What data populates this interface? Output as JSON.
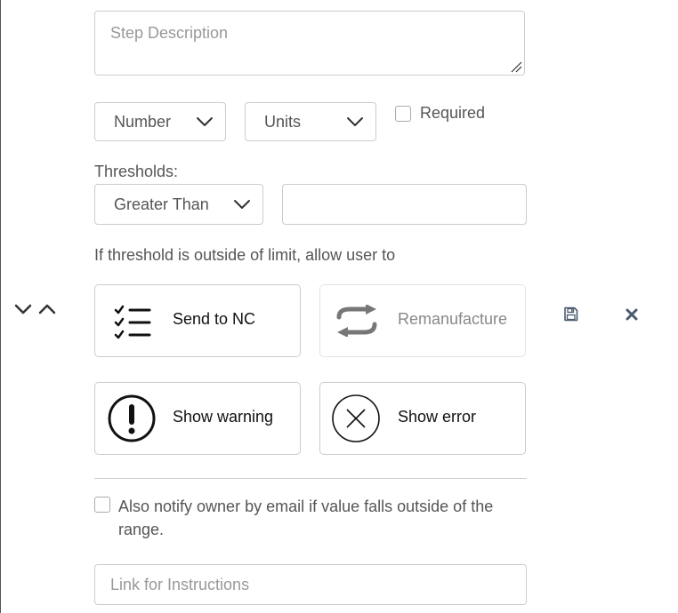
{
  "step": {
    "description_placeholder": "Step Description"
  },
  "measure": {
    "type_value": "Number",
    "units_value": "Units",
    "required_label": "Required"
  },
  "thresholds": {
    "label": "Thresholds:",
    "operator_value": "Greater Than",
    "value": ""
  },
  "outside_limit": {
    "prompt": "If threshold is outside of limit, allow user to",
    "actions": [
      {
        "label": "Send to NC",
        "icon": "checklist-icon",
        "enabled": true
      },
      {
        "label": "Remanufacture",
        "icon": "repeat-arrows-icon",
        "enabled": false
      },
      {
        "label": "Show warning",
        "icon": "exclamation-circle-icon",
        "enabled": true
      },
      {
        "label": "Show error",
        "icon": "x-circle-icon",
        "enabled": true
      }
    ]
  },
  "notify": {
    "label": "Also notify owner by email if value falls outside of the range."
  },
  "instructions": {
    "link_placeholder": "Link for Instructions"
  },
  "controls": {
    "move_down_icon": "chevron-down-icon",
    "move_up_icon": "chevron-up-icon",
    "save_icon": "save-icon",
    "remove_icon": "close-icon"
  },
  "colors": {
    "border": "#cccccc",
    "text": "#555555",
    "placeholder": "#999999",
    "icon_dark": "#111111",
    "icon_muted": "#777777",
    "control_icon": "#4a5a70"
  }
}
